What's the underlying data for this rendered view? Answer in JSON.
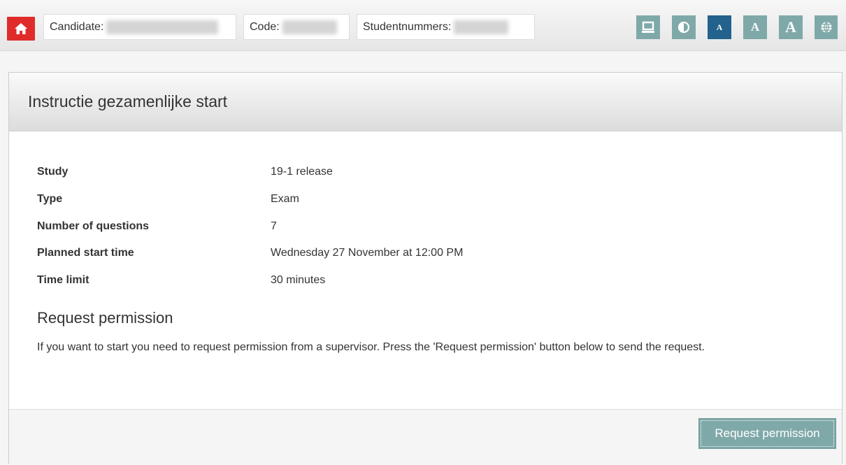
{
  "header": {
    "candidate_label": "Candidate:",
    "code_label": "Code:",
    "student_label": "Studentnummers:",
    "tool_buttons": [
      "monitor-icon",
      "contrast-icon",
      "font-small-icon",
      "font-medium-icon",
      "font-large-icon",
      "globe-icon"
    ],
    "font_letter": "A"
  },
  "panel": {
    "title": "Instructie gezamenlijke start",
    "details": [
      {
        "label": "Study",
        "value": "19-1 release"
      },
      {
        "label": "Type",
        "value": "Exam"
      },
      {
        "label": "Number of questions",
        "value": "7"
      },
      {
        "label": "Planned start time",
        "value": "Wednesday 27 November at 12:00 PM"
      },
      {
        "label": "Time limit",
        "value": "30 minutes"
      }
    ],
    "subheading": "Request permission",
    "paragraph": "If you want to start you need to request permission from a supervisor. Press the 'Request permission' button below to send the request.",
    "button_label": "Request permission"
  },
  "colors": {
    "home": "#e02b2b",
    "tool": "#7fa9a8",
    "tool_active": "#22628d"
  }
}
